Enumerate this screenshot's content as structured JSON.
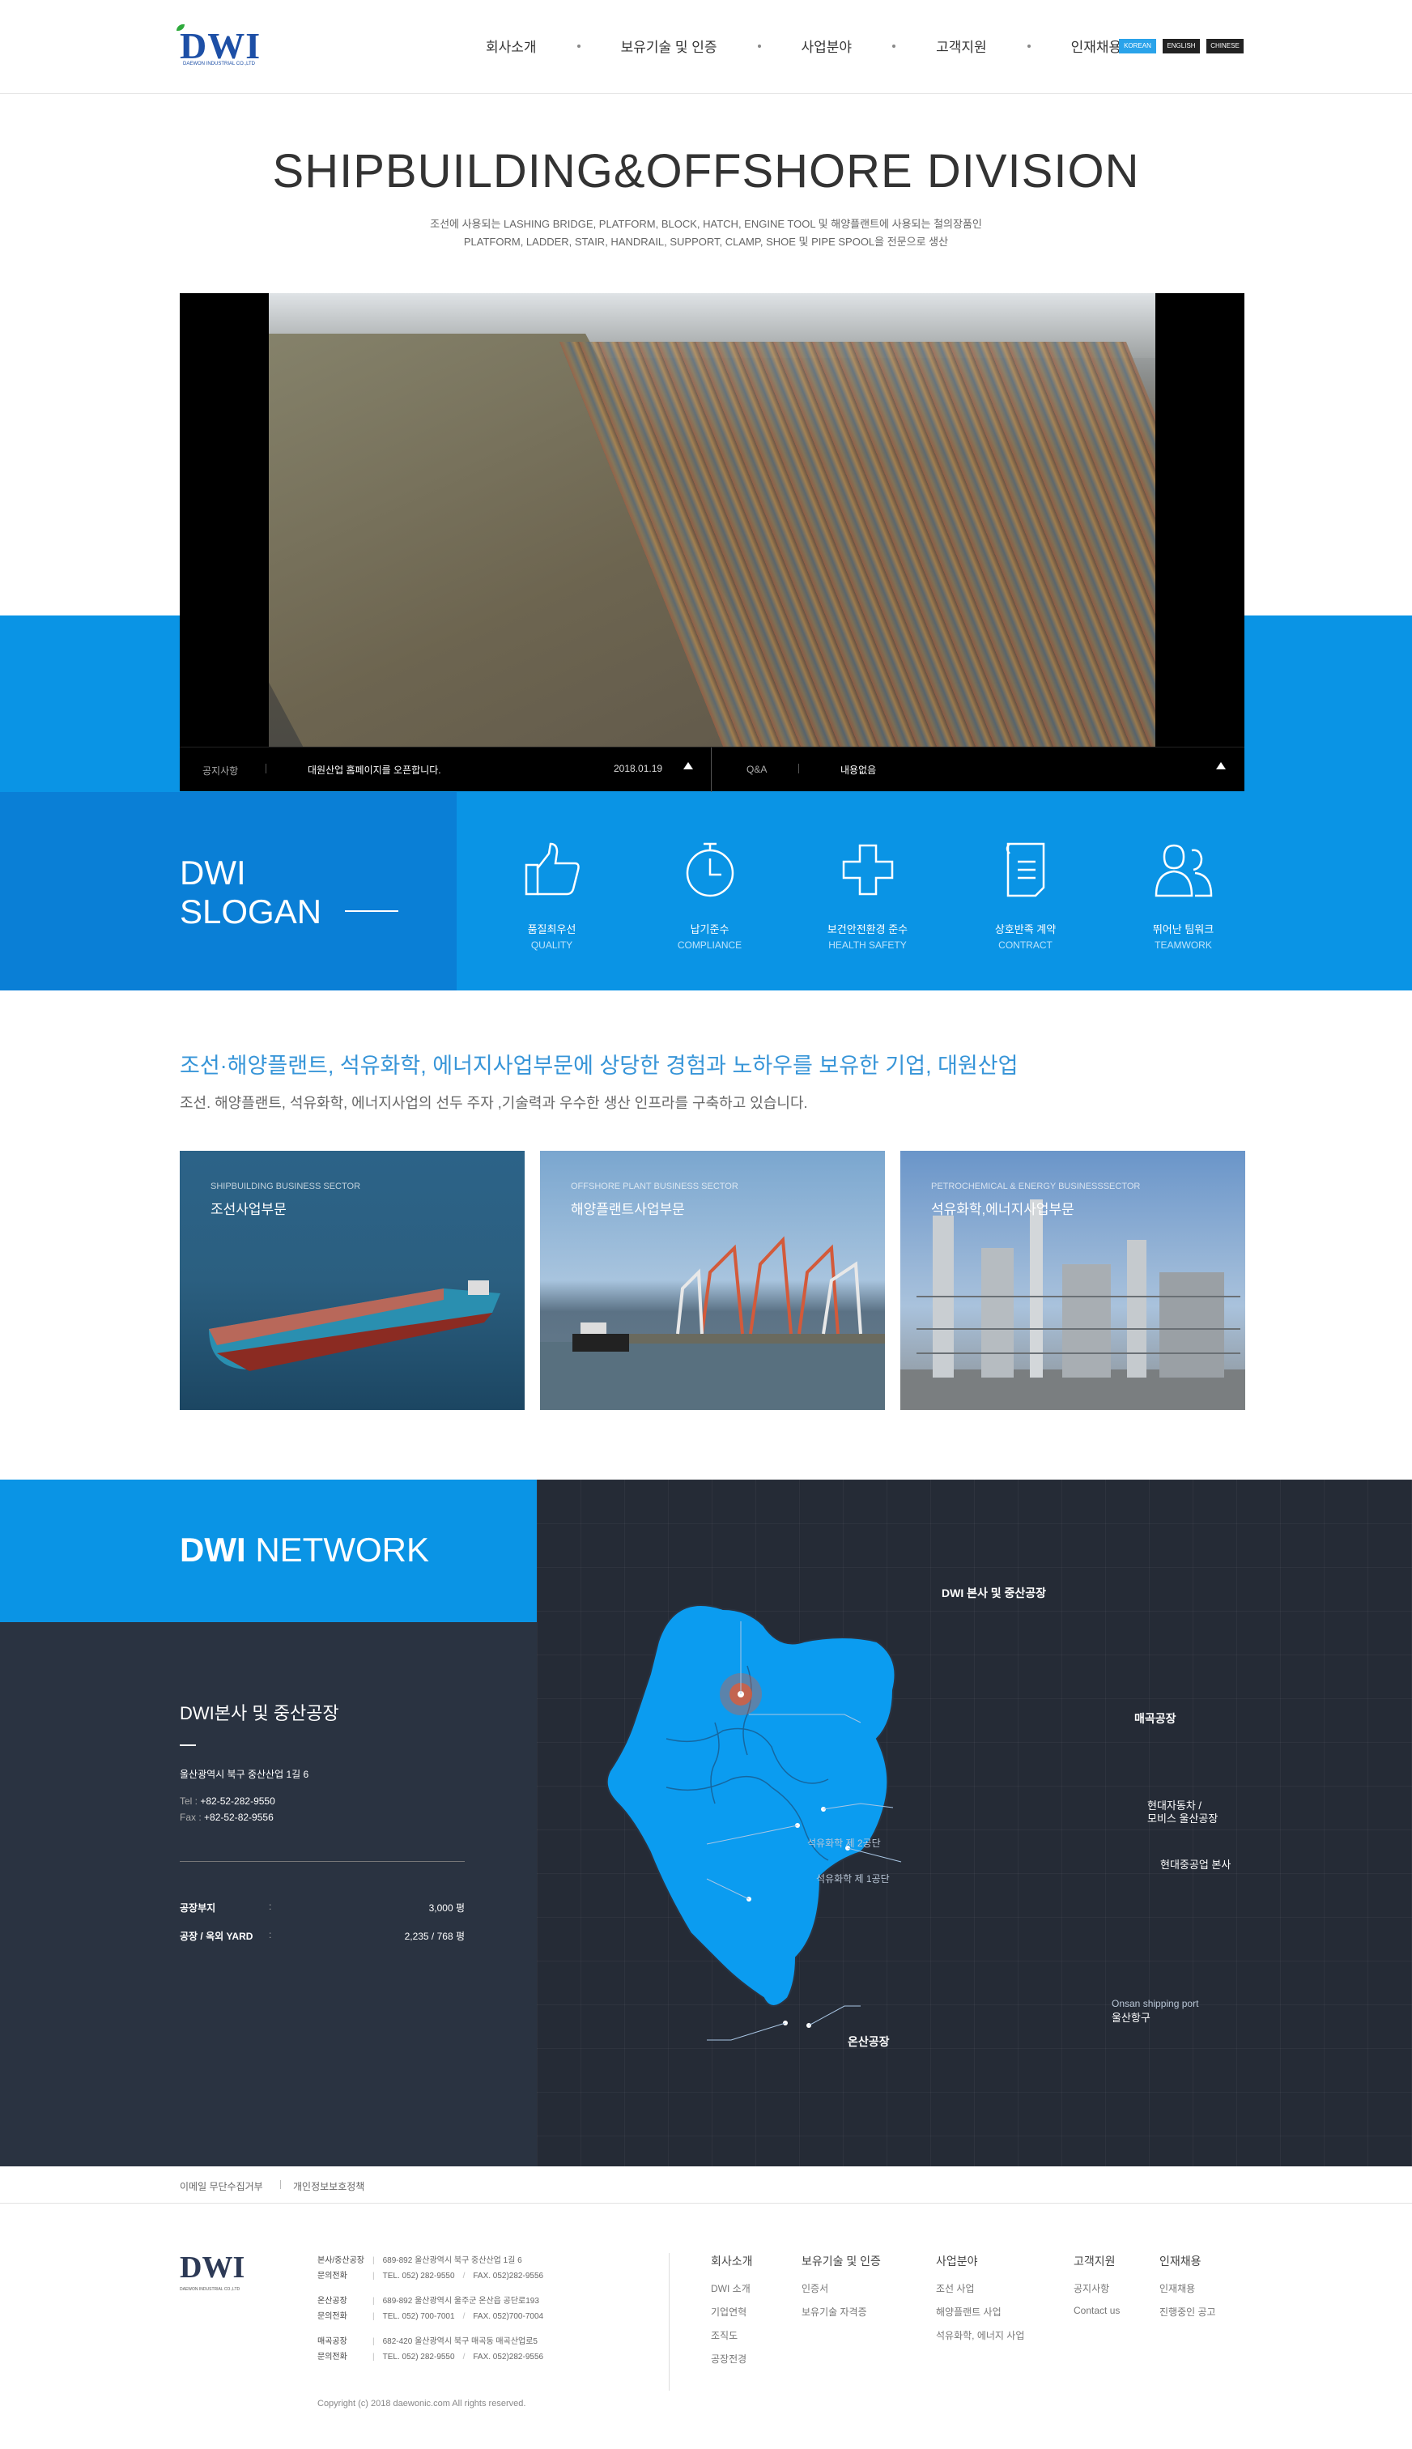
{
  "header": {
    "logo": "DWI",
    "logo_sub": "DAEWON INDUSTRIAL CO.,LTD",
    "nav": [
      "회사소개",
      "보유기술 및 인증",
      "사업분야",
      "고객지원",
      "인재채용"
    ],
    "languages": [
      "KOREAN",
      "ENGLISH",
      "CHINESE"
    ],
    "active_language": "KOREAN"
  },
  "hero": {
    "title": "SHIPBUILDING&OFFSHORE DIVISION",
    "desc_line1": "조선에 사용되는 LASHING BRIDGE, PLATFORM, BLOCK, HATCH, ENGINE TOOL 및 해양플랜트에 사용되는 철의장품인",
    "desc_line2": "PLATFORM, LADDER, STAIR, HANDRAIL, SUPPORT, CLAMP, SHOE 및 PIPE SPOOL을 전문으로 생산"
  },
  "notice_bar": {
    "notice_label": "공지사항",
    "notice_text": "대원산업 홈페이지를 오픈합니다.",
    "notice_date": "2018.01.19",
    "qa_label": "Q&A",
    "qa_text": "내용없음"
  },
  "slogan": {
    "title_line1": "DWI",
    "title_line2": "SLOGAN",
    "items": [
      {
        "ko": "품질최우선",
        "en": "QUALITY",
        "icon": "thumbs-up-icon"
      },
      {
        "ko": "납기준수",
        "en": "COMPLIANCE",
        "icon": "clock-icon"
      },
      {
        "ko": "보건안전환경 준수",
        "en": "HEALTH SAFETY",
        "icon": "health-cross-icon"
      },
      {
        "ko": "상호반족 계약",
        "en": "CONTRACT",
        "icon": "document-icon"
      },
      {
        "ko": "뛰어난 팀워크",
        "en": "TEAMWORK",
        "icon": "team-icon"
      }
    ]
  },
  "business": {
    "title": "조선·해양플랜트, 석유화학, 에너지사업부문에 상당한 경험과 노하우를 보유한 기업, 대원산업",
    "subtitle": "조선. 해양플랜트, 석유화학, 에너지사업의 선두 주자 ,기술력과 우수한 생산 인프라를 구축하고 있습니다.",
    "cards": [
      {
        "en": "SHIPBUILDING BUSINESS SECTOR",
        "ko": "조선사업부문"
      },
      {
        "en": "OFFSHORE PLANT BUSINESS SECTOR",
        "ko": "해양플랜트사업부문"
      },
      {
        "en": "PETROCHEMICAL & ENERGY BUSINESSSECTOR",
        "ko": "석유화학,에너지사업부문"
      }
    ]
  },
  "network": {
    "title_bold": "DWI",
    "title_light": " NETWORK",
    "hq_name": "DWI본사 및 중산공장",
    "hq_address": "울산광역시 북구 중산산업 1길 6",
    "tel_label": "Tel :",
    "tel": "+82-52-282-9550",
    "fax_label": "Fax :",
    "fax": "+82-52-82-9556",
    "rows": [
      {
        "k": "공장부지",
        "v": "3,000 평"
      },
      {
        "k": "공장 / 옥외 YARD",
        "v": "2,235 / 768 평"
      }
    ],
    "map_labels": {
      "hq": "DWI 본사 및 중산공장",
      "maegok": "매곡공장",
      "hyundai_motor": "현대자동차 /",
      "hyundai_mobis": "모비스 울산공장",
      "hyundai_heavy": "현대중공업 본사",
      "petro2": "석유화학 제 2공단",
      "petro1": "석유화학 제 1공단",
      "onsan_port_en": "Onsan shipping port",
      "onsan_port_ko": "울산항구",
      "onsan_factory": "온산공장"
    },
    "colors": {
      "map_fill": "#0b9cf0",
      "marker": "#f0572a"
    }
  },
  "footer": {
    "link1": "이메일 무단수집거부",
    "link2": "개인정보보호정책",
    "logo": "DWI",
    "logo_sub": "DAEWON INDUSTRIAL CO.,LTD",
    "addresses": [
      {
        "l1": "본사/중산공장",
        "a": "689-892 울산광역시 북구 중산산업 1길 6",
        "l2": "문의전화",
        "t": "TEL. 052) 282-9550",
        "f": "FAX. 052)282-9556"
      },
      {
        "l1": "온산공장",
        "a": "689-892 울산광역시 울주군 온산읍 공단로193",
        "l2": "문의전화",
        "t": "TEL. 052) 700-7001",
        "f": "FAX. 052)700-7004"
      },
      {
        "l1": "매곡공장",
        "a": "682-420 울산광역시 북구 매곡동 매곡산업로5",
        "l2": "문의전화",
        "t": "TEL. 052) 282-9550",
        "f": "FAX. 052)282-9556"
      }
    ],
    "copyright": "Copyright (c) 2018 daewonic.com All rights reserved.",
    "columns": [
      {
        "h": "회사소개",
        "items": [
          "DWI 소개",
          "기업연혁",
          "조직도",
          "공장전경"
        ]
      },
      {
        "h": "보유기술 및 인증",
        "items": [
          "인증서",
          "보유기술 자격증"
        ]
      },
      {
        "h": "사업분야",
        "items": [
          "조선 사업",
          "해양플랜트 사업",
          "석유화학, 에너지 사업"
        ]
      },
      {
        "h": "고객지원",
        "items": [
          "공지사항",
          "Contact us"
        ]
      },
      {
        "h": "인재채용",
        "items": [
          "인재채용",
          "진행중인 공고"
        ]
      }
    ]
  }
}
